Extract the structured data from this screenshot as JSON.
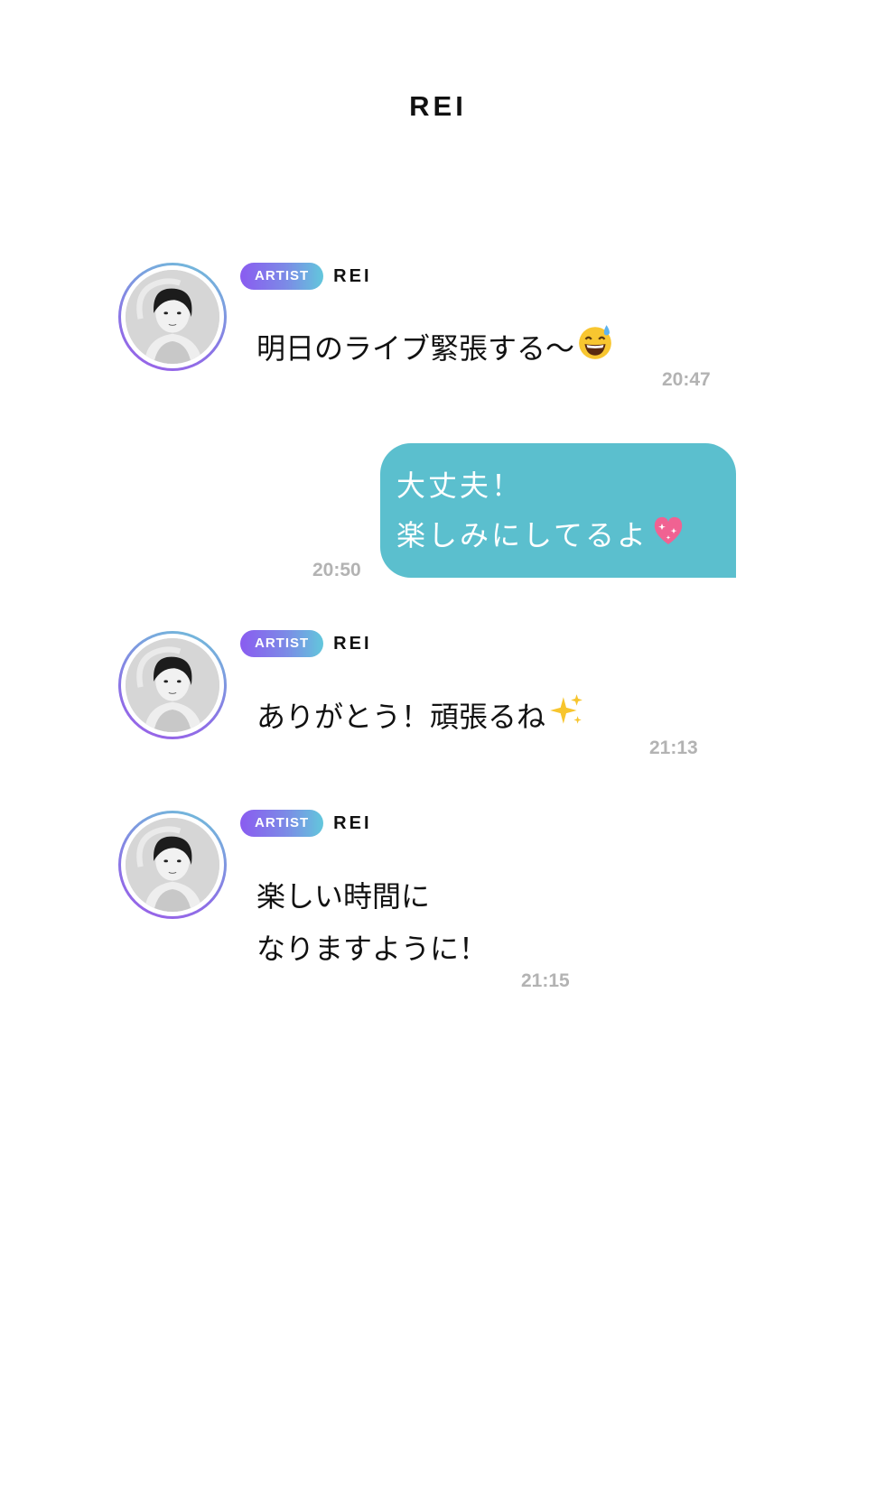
{
  "header": {
    "title": "REI"
  },
  "messages": [
    {
      "badge": "ARTIST",
      "sender": "REI",
      "lines": [
        "明日のライブ緊張する〜"
      ],
      "emoji": "sweat-smile-emoji",
      "time": "20:47"
    },
    {
      "lines": [
        "大丈夫！",
        "楽しみにしてるよ"
      ],
      "emoji": "sparkling-heart-emoji",
      "time": "20:50"
    },
    {
      "badge": "ARTIST",
      "sender": "REI",
      "lines": [
        "ありがとう！頑張るね"
      ],
      "emoji": "sparkles-emoji",
      "time": "21:13"
    },
    {
      "badge": "ARTIST",
      "sender": "REI",
      "lines": [
        "楽しい時間に",
        "なりますように！"
      ],
      "time": "21:15"
    }
  ],
  "colors": {
    "outgoing_bubble": "#5bbfce",
    "badge_gradient_start": "#8a5cf0",
    "badge_gradient_end": "#62c7dc",
    "timestamp": "#b3b3b3"
  }
}
